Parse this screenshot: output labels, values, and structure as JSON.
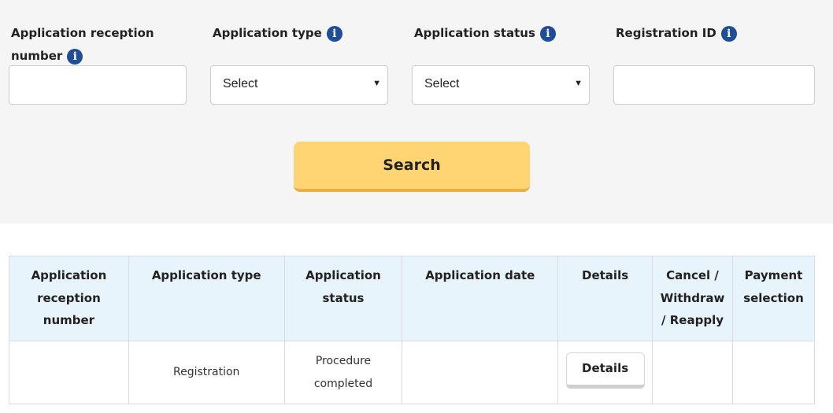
{
  "search": {
    "fields": [
      {
        "label_line1": "Application reception",
        "label_line2": "number",
        "info_icon": "info-icon",
        "value": ""
      },
      {
        "label": "Application type",
        "info_icon": "info-icon",
        "selected": "Select"
      },
      {
        "label": "Application status",
        "info_icon": "info-icon",
        "selected": "Select"
      },
      {
        "label": "Registration ID",
        "info_icon": "info-icon",
        "value": ""
      }
    ],
    "info_glyph": "i",
    "caret": "▼",
    "button_label": "Search"
  },
  "table": {
    "headers": [
      {
        "line1": "Application",
        "line2": "reception",
        "line3": "number"
      },
      {
        "line1": "Application type"
      },
      {
        "line1": "Application",
        "line2": "status"
      },
      {
        "line1": "Application date"
      },
      {
        "line1": "Details"
      },
      {
        "line1": "Cancel /",
        "line2": "Withdraw",
        "line3": "/ Reapply"
      },
      {
        "line1": "Payment",
        "line2": "selection"
      }
    ],
    "rows": [
      {
        "reception_number": "",
        "type": "Registration",
        "status_line1": "Procedure",
        "status_line2": "completed",
        "date": "",
        "details_label": "Details",
        "cancel": "",
        "payment": ""
      }
    ]
  },
  "colors": {
    "panel_bg": "#f5f5f5",
    "button_yellow": "#ffd473",
    "button_border": "#e9b145",
    "header_bg": "#e8f4fc",
    "info_blue": "#1f4e96"
  }
}
